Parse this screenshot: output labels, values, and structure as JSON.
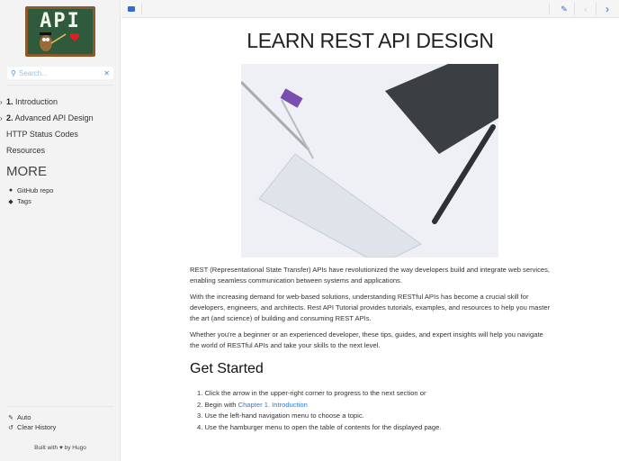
{
  "sidebar": {
    "logo_text": "API",
    "search_placeholder": "Search...",
    "nav": [
      {
        "num": "1.",
        "label": "Introduction",
        "expandable": true
      },
      {
        "num": "2.",
        "label": "Advanced API Design",
        "expandable": true
      },
      {
        "num": "",
        "label": "HTTP Status Codes",
        "expandable": false
      },
      {
        "num": "",
        "label": "Resources",
        "expandable": false
      }
    ],
    "more_heading": "MORE",
    "more_links": [
      {
        "label": "GitHub repo",
        "icon": "github-icon"
      },
      {
        "label": "Tags",
        "icon": "tags-icon"
      }
    ],
    "theme_label": "Auto",
    "clear_history_label": "Clear History",
    "built_with_prefix": "Built with",
    "built_with_suffix": "by Hugo"
  },
  "colors": {
    "accent": "#2f6fd4",
    "link": "#2f7ad8",
    "sidebar_bg": "#f3f3f3"
  },
  "main": {
    "title": "LEARN REST API DESIGN",
    "paragraphs": [
      "REST (Representational State Transfer) APIs have revolutionized the way developers build and integrate web services, enabling seamless communication between systems and applications.",
      "With the increasing demand for web-based solutions, understanding RESTful APIs has become a crucial skill for developers, engineers, and architects. Rest API Tutorial provides tutorials, examples, and resources to help you master the art (and science) of building and consuming REST APIs.",
      "Whether you're a beginner or an experienced developer, these tips, guides, and expert insights will help you navigate the world of RESTful APIs and take your skills to the next level."
    ],
    "get_started_heading": "Get Started",
    "steps": [
      {
        "prefix": "1. Click the arrow in the upper-right corner to progress to the next section or"
      },
      {
        "prefix": "2. Begin with ",
        "link": "Chapter 1. Introduction"
      },
      {
        "prefix": "3. Use the left-hand navigation menu to choose a topic."
      },
      {
        "prefix": "4. Use the hamburger menu to open the table of contents for the displayed page."
      }
    ]
  }
}
